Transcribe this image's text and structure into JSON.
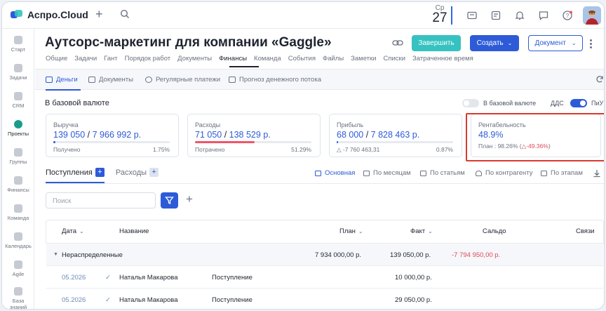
{
  "app": {
    "name": "Аспро.Cloud"
  },
  "topbar": {
    "date_dow": "Ср",
    "date_day": "27"
  },
  "sidebar": {
    "items": [
      {
        "label": "Старт"
      },
      {
        "label": "Задачи"
      },
      {
        "label": "CRM"
      },
      {
        "label": "Проекты"
      },
      {
        "label": "Группы"
      },
      {
        "label": "Финансы"
      },
      {
        "label": "Команда"
      },
      {
        "label": "Календарь"
      },
      {
        "label": "Agile"
      },
      {
        "label": "База"
      },
      {
        "label": "знаний"
      }
    ]
  },
  "project": {
    "title": "Аутсорс-маркетинг для компании «Gaggle»",
    "finish_label": "Завершить",
    "create_label": "Создать",
    "doc_label": "Документ"
  },
  "tabs": [
    "Общие",
    "Задачи",
    "Гант",
    "Порядок работ",
    "Документы",
    "Финансы",
    "Команда",
    "События",
    "Файлы",
    "Заметки",
    "Списки",
    "Затраченное время"
  ],
  "subtabs": [
    "Деньги",
    "Документы",
    "Регулярные платежи",
    "Прогноз денежного потока"
  ],
  "finance": {
    "section_title": "В базовой валюте",
    "toggle_base_label": "В базовой валюте",
    "toggle_dds_label": "ДДС",
    "toggle_piu_label": "ПиУ",
    "cards": {
      "revenue": {
        "label": "Выручка",
        "value_a": "139 050",
        "sep": " / ",
        "value_b": "7 966 992 р.",
        "sub": "Получено",
        "pct": "1.75%",
        "progress": 0.0175,
        "color": "#2d5bd8"
      },
      "expenses": {
        "label": "Расходы",
        "value_a": "71 050",
        "sep": " / ",
        "value_b": "138 529 р.",
        "sub": "Потрачено",
        "pct": "51.29%",
        "progress": 0.5129,
        "color": "#f0546a"
      },
      "profit": {
        "label": "Прибыль",
        "value_a": "68 000",
        "sep": " / ",
        "value_b": "7 828 463 р.",
        "sub": "-7 760 463,31",
        "pct": "0.87%",
        "progress": 0.0087,
        "color": "#2d5bd8"
      },
      "margin": {
        "label": "Рентабельность",
        "value": "48.9%",
        "plan_prefix": "План : 98.26% (",
        "plan_delta": "-49.36%",
        "plan_suffix": ")"
      }
    }
  },
  "payments": {
    "tab_income": "Поступления",
    "tab_expense": "Расходы",
    "views": [
      "Основная",
      "По месяцам",
      "По статьям",
      "По контрагенту",
      "По этапам"
    ],
    "search_placeholder": "Поиск",
    "columns": [
      "Дата",
      "Название",
      "План",
      "Факт",
      "Сальдо",
      "Связи"
    ],
    "group": {
      "label": "Нераспределенные",
      "plan": "7 934 000,00 р.",
      "fact": "139 050,00 р.",
      "saldo": "-7 794 950,00 р."
    },
    "rows": [
      {
        "date": "05.2026",
        "name": "Наталья Макарова",
        "type": "Поступление",
        "fact": "10 000,00 р."
      },
      {
        "date": "05.2026",
        "name": "Наталья Макарова",
        "type": "Поступление",
        "fact": "29 050,00 р."
      }
    ]
  }
}
